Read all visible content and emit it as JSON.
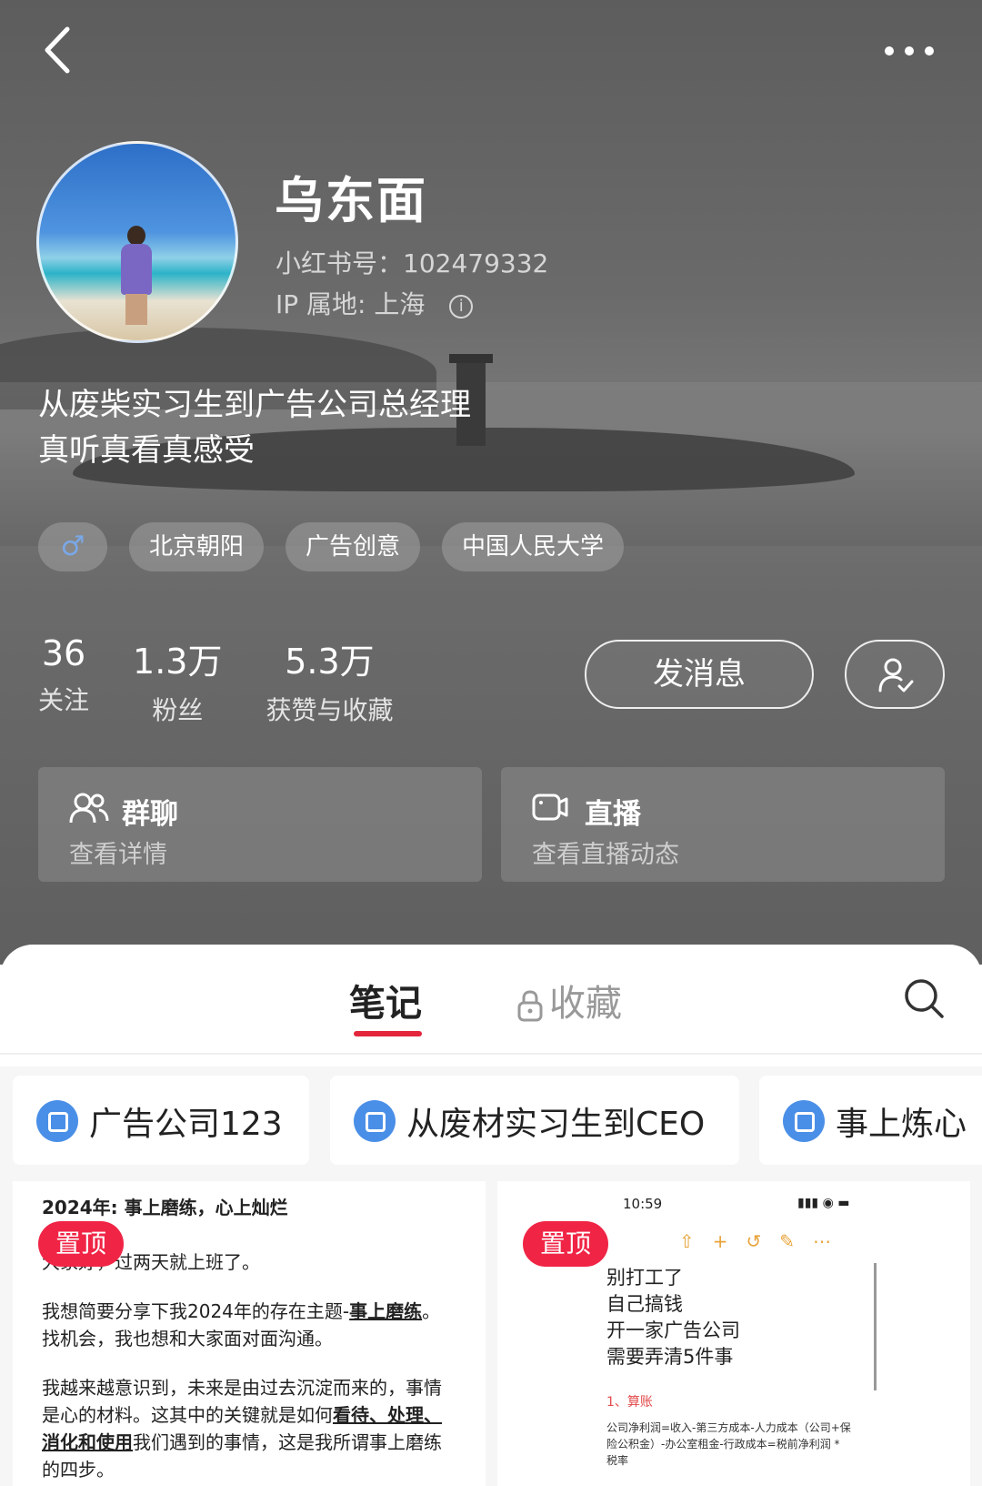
{
  "header": {
    "back_icon": "chevron-left-icon",
    "more_icon": "more-horizontal-icon"
  },
  "profile": {
    "name": "乌东面",
    "redbook_id": "小红书号：102479332",
    "ip_location": "IP 属地: 上海",
    "bio_line1": "从废柴实习生到广告公司总经理",
    "bio_line2": "真听真看真感受",
    "gender_symbol": "♂",
    "tags": [
      "北京朝阳",
      "广告创意",
      "中国人民大学"
    ]
  },
  "stats": [
    {
      "value": "36",
      "label": "关注"
    },
    {
      "value": "1.3万",
      "label": "粉丝"
    },
    {
      "value": "5.3万",
      "label": "获赞与收藏"
    }
  ],
  "actions": {
    "message_label": "发消息",
    "following_icon": "user-check-icon"
  },
  "cards": {
    "group_title": "群聊",
    "group_sub": "查看详情",
    "live_title": "直播",
    "live_sub": "查看直播动态"
  },
  "tabs": {
    "notes": "笔记",
    "favorites": "收藏"
  },
  "collections": [
    "广告公司123",
    "从废材实习生到CEO",
    "事上炼心"
  ],
  "posts": [
    {
      "pin_label": "置顶",
      "title": "2024年: 事上磨练，心上灿烂",
      "line1": "大家好，过两天就上班了。",
      "line2a": "我想简要分享下我2024年的存在主题-",
      "line2b": "事上磨练",
      "line2c": "。",
      "line3": "找机会，我也想和大家面对面沟通。",
      "line4": "我越来越意识到，未来是由过去沉淀而来的，事情",
      "line5a": "是心的材料。这其中的关键就是如何",
      "line5b": "看待、处理、",
      "line6a": "消化和使用",
      "line6b": "我们遇到的事情，这是我所谓事上磨练",
      "line7": "的四步。"
    },
    {
      "pin_label": "置顶",
      "time": "10:59",
      "line1": "别打工了",
      "line2": "自己搞钱",
      "line3": "开一家广告公司",
      "line4": "需要弄清5件事",
      "heading": "1、算账",
      "small1": "公司净利润=收入-第三方成本-人力成本（公司+保",
      "small2": "险公积金）-办公室租金-行政成本=税前净利润 *",
      "small3": "税率"
    }
  ]
}
